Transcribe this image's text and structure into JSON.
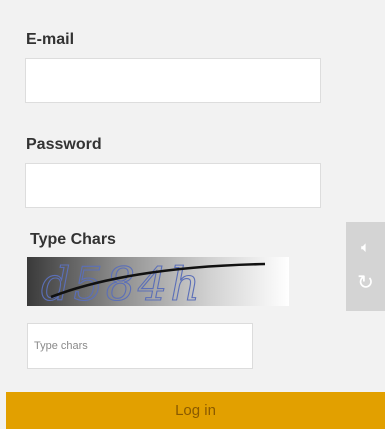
{
  "email": {
    "label": "E-mail",
    "value": "",
    "placeholder": ""
  },
  "password": {
    "label": "Password",
    "value": "",
    "placeholder": ""
  },
  "captcha": {
    "label": "Type Chars",
    "image_text": "d584h",
    "input_placeholder": "Type chars",
    "audio_icon": "speaker-icon",
    "refresh_icon": "refresh-icon"
  },
  "login": {
    "label": "Log in"
  },
  "colors": {
    "background": "#f2f2f2",
    "button": "#e2a000",
    "button_text": "#8a5a00",
    "side_panel": "#d4d4d4"
  }
}
